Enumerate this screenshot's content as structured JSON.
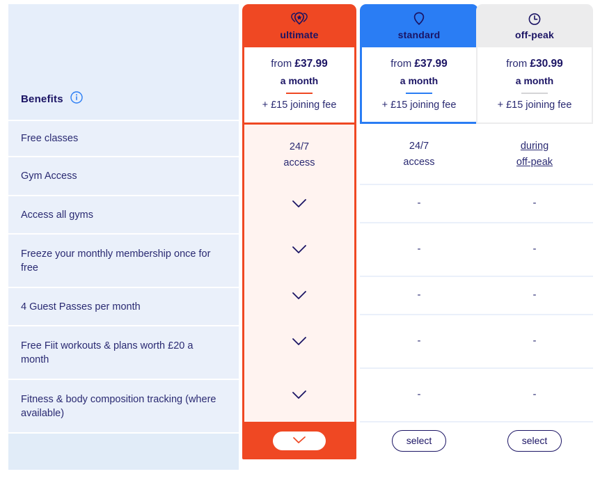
{
  "benefits": {
    "title": "Benefits",
    "info_icon": "info-icon",
    "rows": [
      {
        "label": "Free classes"
      },
      {
        "label": "Gym Access"
      },
      {
        "label": "Access all gyms"
      },
      {
        "label": "Freeze your monthly membership once for free"
      },
      {
        "label": "4 Guest Passes per month"
      },
      {
        "label": "Free Fiit workouts & plans worth £20 a month"
      },
      {
        "label": "Fitness & body composition tracking (where available)"
      }
    ]
  },
  "plans": [
    {
      "key": "ultimate",
      "name": "ultimate",
      "icon": "pins-star-icon",
      "header_color": "#ef4823",
      "accent_color": "#ef4823",
      "price_from": "from",
      "price": "£37.99",
      "period": "a month",
      "joining_fee": "+ £15 joining fee",
      "access_line1": "24/7",
      "access_line2": "access",
      "features": [
        "✓",
        "✓",
        "✓",
        "✓",
        "✓"
      ],
      "cta": "",
      "selected": true
    },
    {
      "key": "standard",
      "name": "standard",
      "icon": "pin-icon",
      "header_color": "#2a7df4",
      "accent_color": "#2a7df4",
      "price_from": "from",
      "price": "£37.99",
      "period": "a month",
      "joining_fee": "+ £15 joining fee",
      "access_line1": "24/7",
      "access_line2": "access",
      "features": [
        "-",
        "-",
        "-",
        "-",
        "-"
      ],
      "cta": "select",
      "selected": false
    },
    {
      "key": "offpeak",
      "name": "off-peak",
      "icon": "clock-icon",
      "header_color": "#ececed",
      "accent_color": "#d4d4d6",
      "price_from": "from",
      "price": "£30.99",
      "period": "a month",
      "joining_fee": "+ £15 joining fee",
      "access_line1": "during",
      "access_line2": "off-peak",
      "features": [
        "-",
        "-",
        "-",
        "-",
        "-"
      ],
      "cta": "select",
      "selected": false
    }
  ]
}
